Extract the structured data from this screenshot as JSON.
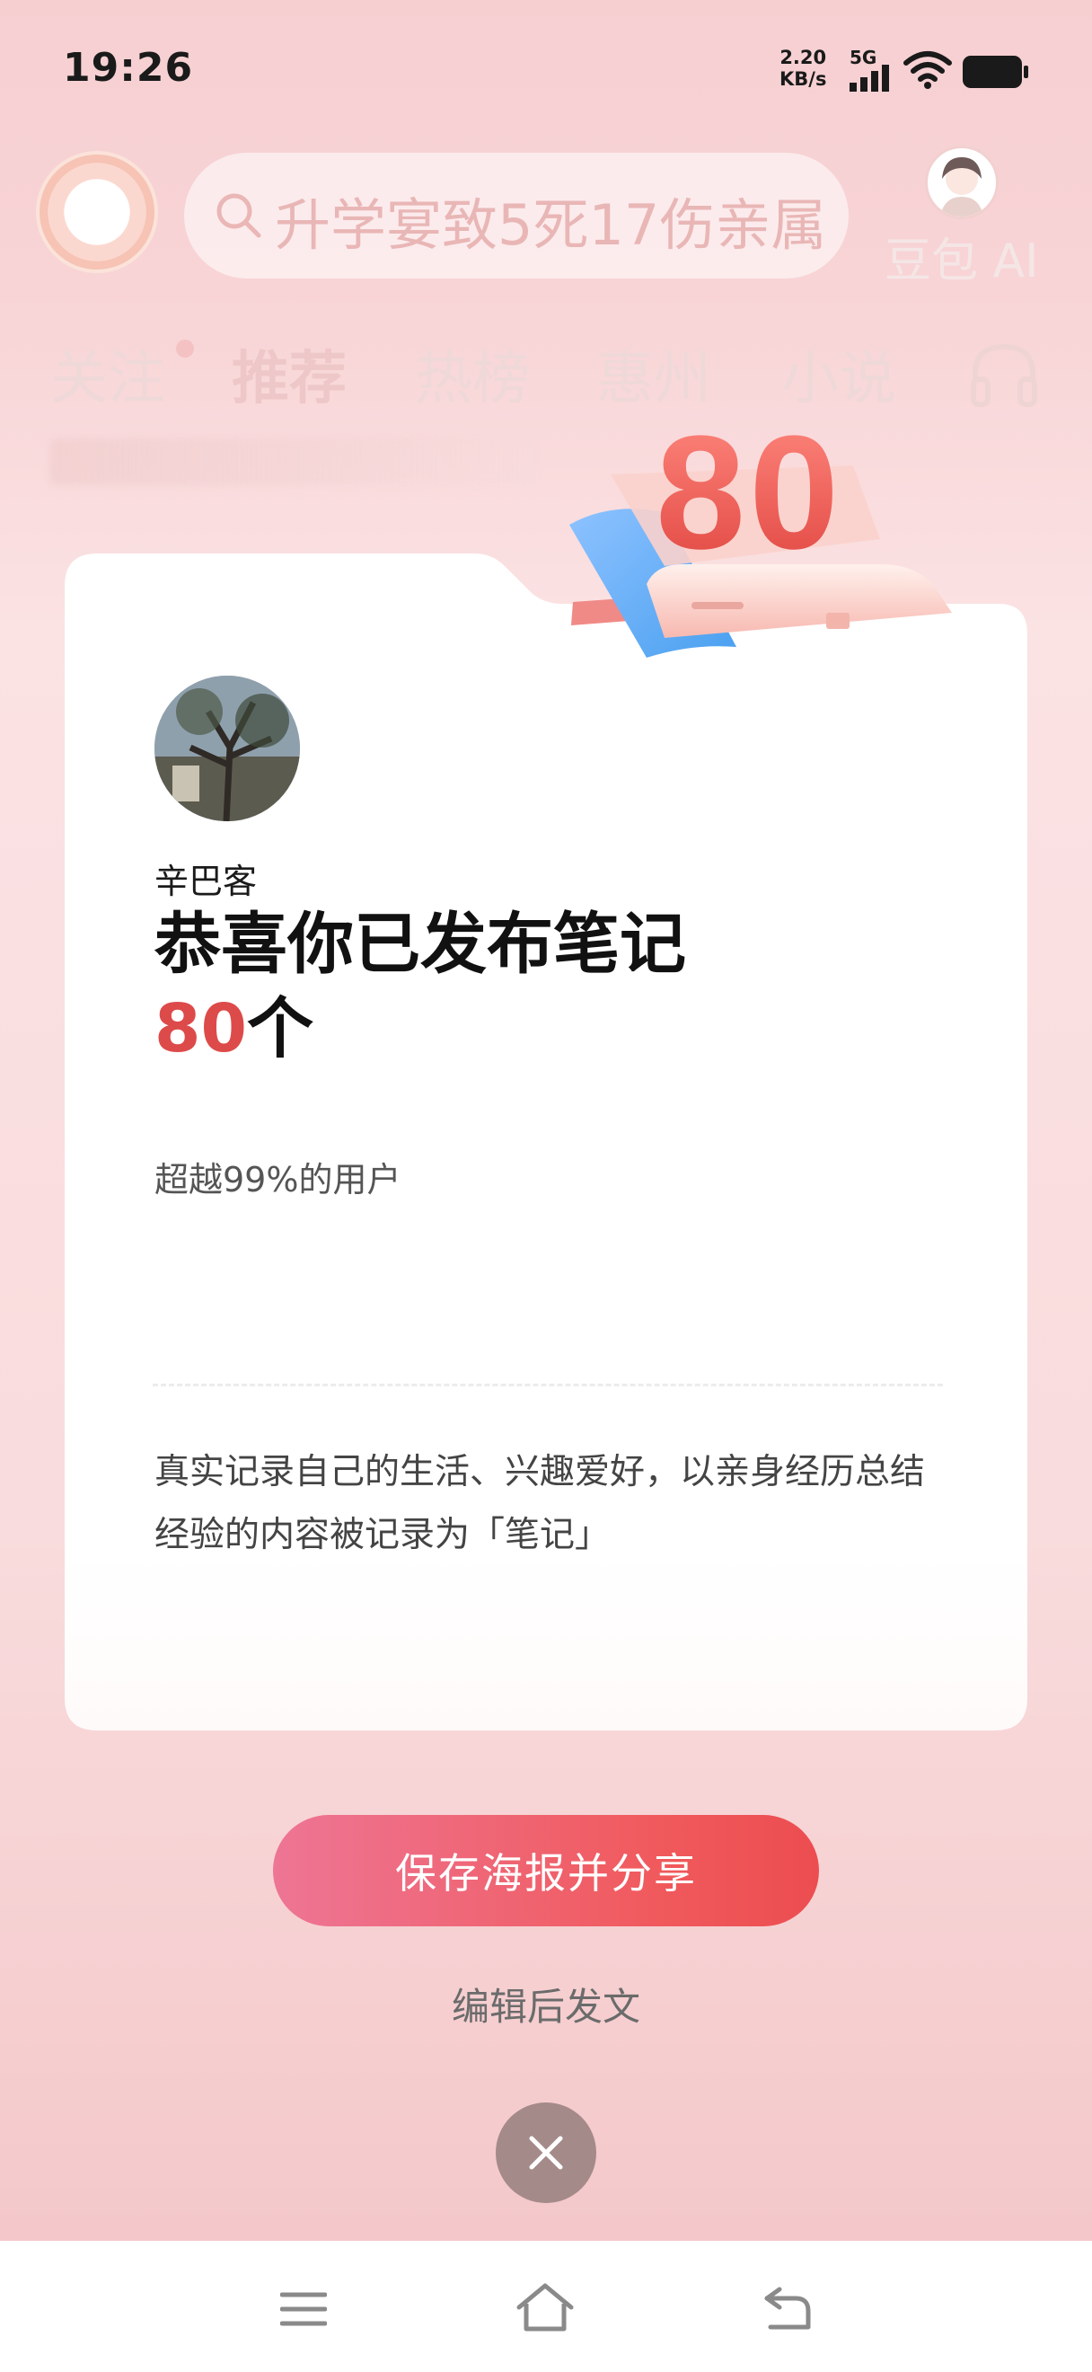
{
  "status_bar": {
    "time": "19:26",
    "net_speed_value": "2.20",
    "net_speed_unit": "KB/s",
    "signal_label": "5G",
    "icons": [
      "signal-bars-icon",
      "wifi-icon",
      "battery-icon"
    ]
  },
  "app_bar": {
    "logo_icon": "app-logo-icon",
    "search_placeholder": "升学宴致5死17伤亲属",
    "search_icon": "search-icon",
    "ai_label": "豆包 AI"
  },
  "tabs": [
    {
      "label": "关注"
    },
    {
      "label": "推荐"
    },
    {
      "label": "热榜"
    },
    {
      "label": "惠州"
    },
    {
      "label": "小说"
    }
  ],
  "tabs_audio_icon": "headphone-icon",
  "badge": {
    "number": "80"
  },
  "card": {
    "username": "辛巴客",
    "headline": "恭喜你已发布笔记",
    "count_value": "80",
    "count_unit": "个",
    "percent_text": "超越99%的用户",
    "description": "真实记录自己的生活、兴趣爱好，以亲身经历总结经验的内容被记录为「笔记」"
  },
  "actions": {
    "share_label": "保存海报并分享",
    "edit_label": "编辑后发文",
    "close_icon": "close-icon"
  },
  "nav_bar": {
    "icons": [
      "menu-icon",
      "home-icon",
      "back-icon"
    ]
  },
  "colors": {
    "accent_red": "#dd4a4a",
    "button_gradient_start": "#ee7595",
    "button_gradient_end": "#ec4d50",
    "page_bg": "#f8d4d6"
  }
}
